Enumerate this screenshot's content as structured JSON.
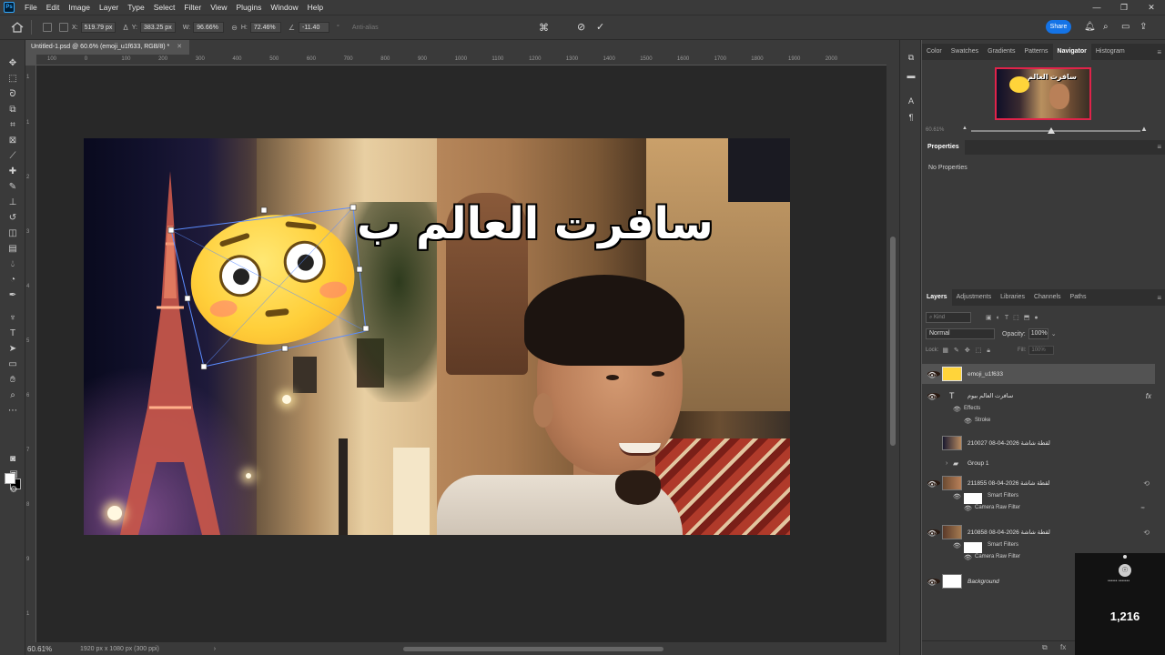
{
  "menubar": {
    "logo": "Ps",
    "items": [
      "File",
      "Edit",
      "Image",
      "Layer",
      "Type",
      "Select",
      "Filter",
      "View",
      "Plugins",
      "Window",
      "Help"
    ],
    "window_controls": [
      "—",
      "❐",
      "✕"
    ]
  },
  "options": {
    "x_label": "X:",
    "x_value": "519.79 px",
    "y_label": "Y:",
    "y_value": "383.25 px",
    "w_label": "W:",
    "w_value": "96.66%",
    "h_label": "H:",
    "h_value": "72.46%",
    "angle_value": "-11.40",
    "interp": "Anti-alias",
    "share_label": "Share"
  },
  "document": {
    "tab_title": "Untitled-1.psd @ 60.6% (emoji_u1f633, RGB/8) *",
    "ruler_ticks": [
      "100",
      "0",
      "100",
      "200",
      "300",
      "400",
      "500",
      "600",
      "700",
      "800",
      "900",
      "1000",
      "1100",
      "1200",
      "1300",
      "1400",
      "1500",
      "1600",
      "1700",
      "1800",
      "1900",
      "2000"
    ],
    "canvas_text": "سافرت العالم ب",
    "zoom": "60.61%",
    "doc_info": "1920 px x 1080 px (300 ppi)"
  },
  "panels": {
    "top_tabs": [
      "Color",
      "Swatches",
      "Gradients",
      "Patterns",
      "Navigator",
      "Histogram"
    ],
    "active_top_tab": "Navigator",
    "nav_text": "سافرت العالم",
    "nav_zoom": "60.61%",
    "properties_tab": "Properties",
    "properties_body": "No Properties",
    "layer_tabs": [
      "Layers",
      "Adjustments",
      "Libraries",
      "Channels",
      "Paths"
    ],
    "kind_placeholder": "Kind",
    "blend_mode": "Normal",
    "opacity_label": "Opacity:",
    "opacity_value": "100%",
    "lock_label": "Lock:",
    "fill_label": "Fill:",
    "fill_value": "100%"
  },
  "layers": [
    {
      "name": "emoji_u1f633",
      "type": "image",
      "visible": true,
      "selected": true
    },
    {
      "name": "سافرت العالم بيوم",
      "type": "text",
      "visible": true,
      "fx": "fx"
    },
    {
      "name": "لقطة شاشة 2026-04-08 210027",
      "type": "image",
      "visible": false
    },
    {
      "name": "Group 1",
      "type": "group",
      "visible": false
    },
    {
      "name": "لقطة شاشة 2026-04-08 211855",
      "type": "smart",
      "visible": true
    },
    {
      "name": "لقطة شاشة 2026-04-08 210858",
      "type": "smart",
      "visible": true
    },
    {
      "name": "Background",
      "type": "background",
      "visible": true
    }
  ],
  "layer_subs": {
    "effects": "Effects",
    "stroke": "Stroke",
    "smart_filters": "Smart Filters",
    "camera_raw": "Camera Raw Filter"
  },
  "overlay": {
    "small_text": "•••••• •••••••",
    "count": "1,216"
  },
  "icons": {
    "home": "home-icon",
    "check": "commit-check-icon",
    "cancel": "cancel-transform-icon",
    "bell": "bell-icon",
    "search": "search-icon",
    "workspace": "workspace-icon"
  },
  "colors": {
    "accent": "#1473e6",
    "panel": "#3a3a3a",
    "canvas": "#282828",
    "nav_frame": "#e0234a"
  }
}
